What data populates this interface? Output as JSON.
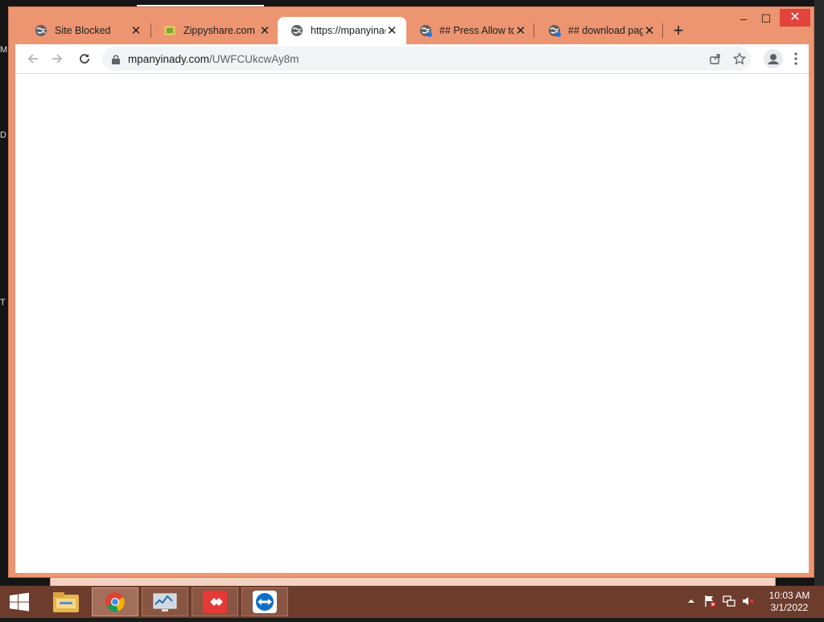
{
  "desktop": {
    "peek_letters": [
      "M",
      "D",
      "T"
    ]
  },
  "window": {
    "minimize_label": "–",
    "maximize_label": "☐",
    "close_label": "✕"
  },
  "tabs": [
    {
      "title": "Site Blocked",
      "icon": "globe-icon"
    },
    {
      "title": "Zippyshare.com -",
      "icon": "zippyshare-favicon"
    },
    {
      "title": "https://mpanyinad",
      "icon": "globe-icon",
      "active": true
    },
    {
      "title": "## Press Allow to",
      "icon": "globe-icon"
    },
    {
      "title": "## download pag",
      "icon": "globe-icon"
    }
  ],
  "tab_close_label": "✕",
  "new_tab_label": "+",
  "address": {
    "domain": "mpanyinady.com",
    "path": "/UWFCUkcwAy8m"
  },
  "taskbar": {
    "clock_time": "10:03 AM",
    "clock_date": "3/1/2022"
  },
  "colors": {
    "frame": "#ed9470",
    "taskbar": "#6d3c2c",
    "close_hover": "#e0443a"
  }
}
